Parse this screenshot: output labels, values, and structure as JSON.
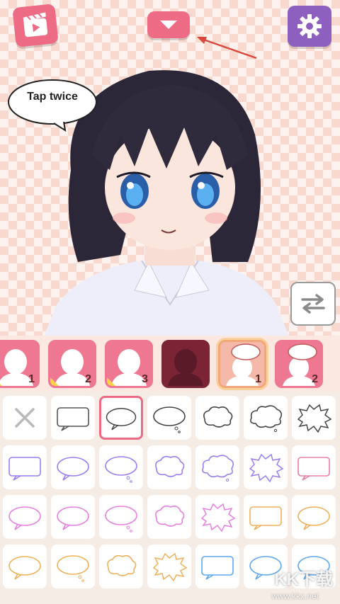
{
  "hint": {
    "text": "Tap twice"
  },
  "toolbar": {
    "video_icon": "clapperboard-play-icon",
    "collapse_icon": "chevron-down-icon",
    "settings_icon": "gear-icon",
    "swap_icon": "swap-arrows-icon"
  },
  "categories": [
    {
      "name": "body-1",
      "number": "1"
    },
    {
      "name": "body-2",
      "number": "2"
    },
    {
      "name": "body-3",
      "number": "3"
    },
    {
      "name": "body-hidden",
      "number": ""
    },
    {
      "name": "speech-bubble-1",
      "number": "1"
    },
    {
      "name": "speech-bubble-2",
      "number": "2"
    }
  ],
  "bubble_grid": {
    "selected_index": 2,
    "items": [
      {
        "shape": "none",
        "color": "#b9b9b9"
      },
      {
        "shape": "rect",
        "color": "#555555"
      },
      {
        "shape": "oval",
        "color": "#444444"
      },
      {
        "shape": "oval-tail",
        "color": "#444444"
      },
      {
        "shape": "cloud",
        "color": "#444444"
      },
      {
        "shape": "cloud2",
        "color": "#444444"
      },
      {
        "shape": "burst",
        "color": "#444444"
      },
      {
        "shape": "rect",
        "color": "#9a7ef0"
      },
      {
        "shape": "oval",
        "color": "#9a7ef0"
      },
      {
        "shape": "oval-tail",
        "color": "#9a7ef0"
      },
      {
        "shape": "cloud",
        "color": "#9a7ef0"
      },
      {
        "shape": "cloud2",
        "color": "#9a7ef0"
      },
      {
        "shape": "burst",
        "color": "#9a7ef0"
      },
      {
        "shape": "rect",
        "color": "#e87ea8"
      },
      {
        "shape": "oval",
        "color": "#e77ee0"
      },
      {
        "shape": "oval",
        "color": "#e77ee0"
      },
      {
        "shape": "oval-tail",
        "color": "#e77ee0"
      },
      {
        "shape": "cloud",
        "color": "#e77ee0"
      },
      {
        "shape": "burst",
        "color": "#e77ee0"
      },
      {
        "shape": "rect",
        "color": "#f0b05a"
      },
      {
        "shape": "oval",
        "color": "#f0b05a"
      },
      {
        "shape": "oval",
        "color": "#f0b05a"
      },
      {
        "shape": "oval-tail",
        "color": "#f0b05a"
      },
      {
        "shape": "cloud",
        "color": "#f0b05a"
      },
      {
        "shape": "burst",
        "color": "#f0b05a"
      },
      {
        "shape": "rect",
        "color": "#5ea7ee"
      },
      {
        "shape": "oval",
        "color": "#5ea7ee"
      },
      {
        "shape": "oval",
        "color": "#5ea7ee"
      }
    ]
  },
  "watermark": {
    "text": "KK下载",
    "url": "www.kkx.net"
  }
}
